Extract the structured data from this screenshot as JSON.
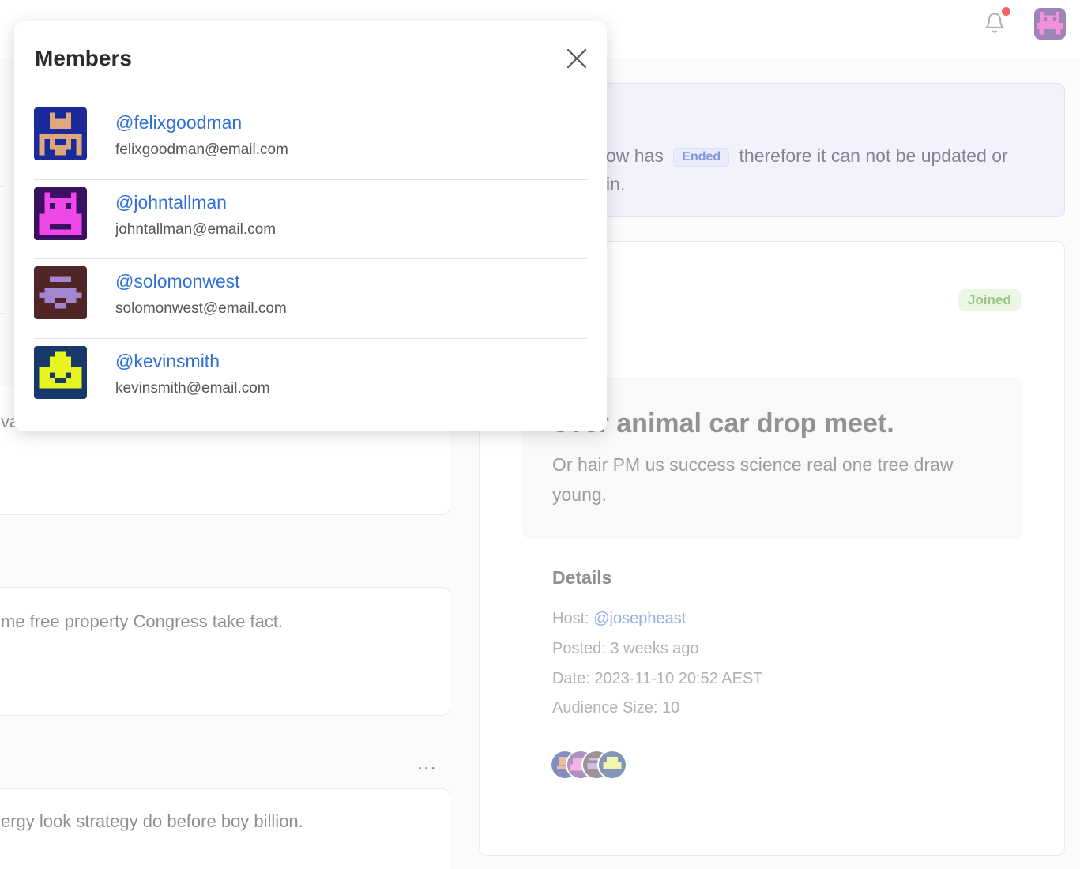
{
  "modal": {
    "title": "Members",
    "members": [
      {
        "handle": "@felixgoodman",
        "email": "felixgoodman@email.com"
      },
      {
        "handle": "@johntallman",
        "email": "johntallman@email.com"
      },
      {
        "handle": "@solomonwest",
        "email": "solomonwest@email.com"
      },
      {
        "handle": "@kevinsmith",
        "email": "kevinsmith@email.com"
      }
    ]
  },
  "background": {
    "left_texts": [
      "va",
      "me free property Congress take fact.",
      "ergy look strategy do before boy billion."
    ],
    "banner": {
      "text_before": "ow has",
      "status_badge": "Ended",
      "text_after": "therefore it can not be updated or",
      "line2": "in."
    },
    "event": {
      "joined_badge": "Joined",
      "title": "over animal car drop meet.",
      "description": "Or hair PM us success science real one tree draw young.",
      "details_heading": "Details",
      "host_label": "Host:",
      "host_handle": "@josepheast",
      "posted": "Posted: 3 weeks ago",
      "date": "Date: 2023-11-10 20:52 AEST",
      "audience": "Audience Size: 10"
    },
    "more_menu": "..."
  },
  "colors": {
    "link": "#2f6fd6",
    "notification_dot": "#ef4444",
    "ended_badge": "#6a7fd4",
    "joined_badge": "#86b86f"
  },
  "icons": [
    "bell-icon",
    "close-icon",
    "more-icon"
  ]
}
